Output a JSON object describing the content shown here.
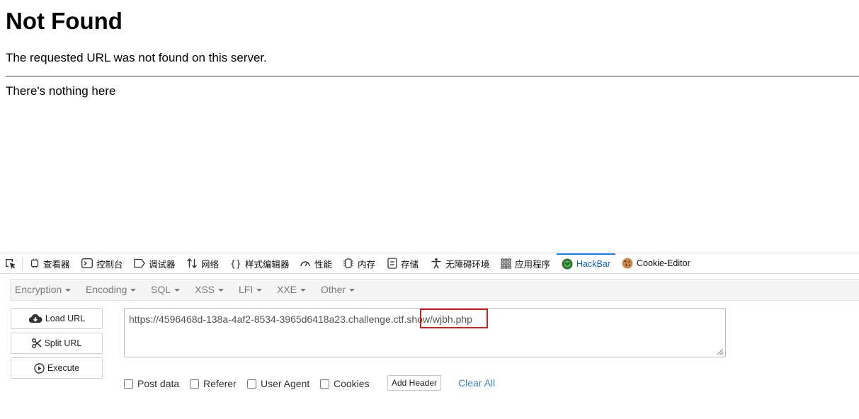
{
  "page": {
    "title": "Not Found",
    "message": "The requested URL was not found on this server.",
    "extra": "There's nothing here"
  },
  "devtools": {
    "tabs": [
      {
        "label": "查看器",
        "icon": "inspector-icon"
      },
      {
        "label": "控制台",
        "icon": "console-icon"
      },
      {
        "label": "调试器",
        "icon": "debugger-icon"
      },
      {
        "label": "网络",
        "icon": "network-icon"
      },
      {
        "label": "样式编辑器",
        "icon": "style-editor-icon"
      },
      {
        "label": "性能",
        "icon": "performance-icon"
      },
      {
        "label": "内存",
        "icon": "memory-icon"
      },
      {
        "label": "存储",
        "icon": "storage-icon"
      },
      {
        "label": "无障碍环境",
        "icon": "accessibility-icon"
      },
      {
        "label": "应用程序",
        "icon": "application-icon"
      },
      {
        "label": "HackBar",
        "icon": "hackbar-icon",
        "active": true
      },
      {
        "label": "Cookie-Editor",
        "icon": "cookie-icon"
      }
    ],
    "active_color": "#0a63c9"
  },
  "hackbar": {
    "menu": [
      "Encryption",
      "Encoding",
      "SQL",
      "XSS",
      "LFI",
      "XXE",
      "Other"
    ],
    "buttons": {
      "load": "Load URL",
      "split": "Split URL",
      "execute": "Execute"
    },
    "url": "https://4596468d-138a-4af2-8534-3965d6418a23.challenge.ctf.show/wjbh.php",
    "options": {
      "post_data": "Post data",
      "referer": "Referer",
      "user_agent": "User Agent",
      "cookies": "Cookies"
    },
    "add_header": "Add Header",
    "clear_all": "Clear All",
    "highlight_color": "#d51e1e"
  }
}
